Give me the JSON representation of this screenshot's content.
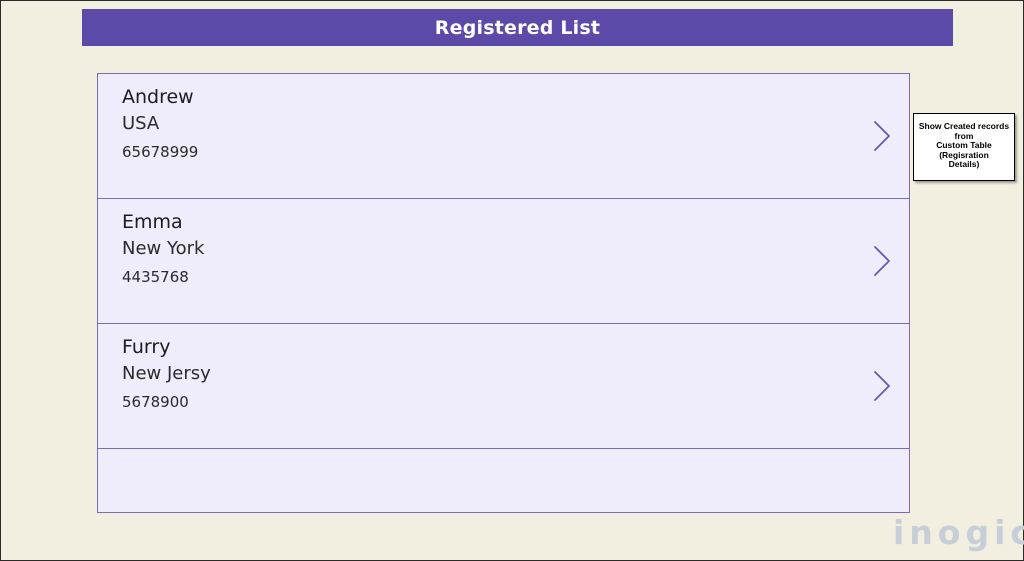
{
  "header": {
    "title": "Registered List"
  },
  "records": [
    {
      "name": "Andrew",
      "city": "USA",
      "phone": "65678999"
    },
    {
      "name": "Emma",
      "city": "New York",
      "phone": "4435768"
    },
    {
      "name": "Furry",
      "city": "New Jersy",
      "phone": "5678900"
    }
  ],
  "callout": {
    "text": "Show Created records\nfrom\nCustom Table\n(Regisration\nDetails)"
  },
  "logo": {
    "text": "inogic"
  },
  "colors": {
    "header_bg": "#5d4aa8",
    "gallery_bg": "#efedfc",
    "gallery_border": "#7b6bb4",
    "page_bg": "#f2eee0",
    "chevron": "#6a58b0"
  },
  "icons": {
    "row_next": "chevron-right-icon"
  }
}
